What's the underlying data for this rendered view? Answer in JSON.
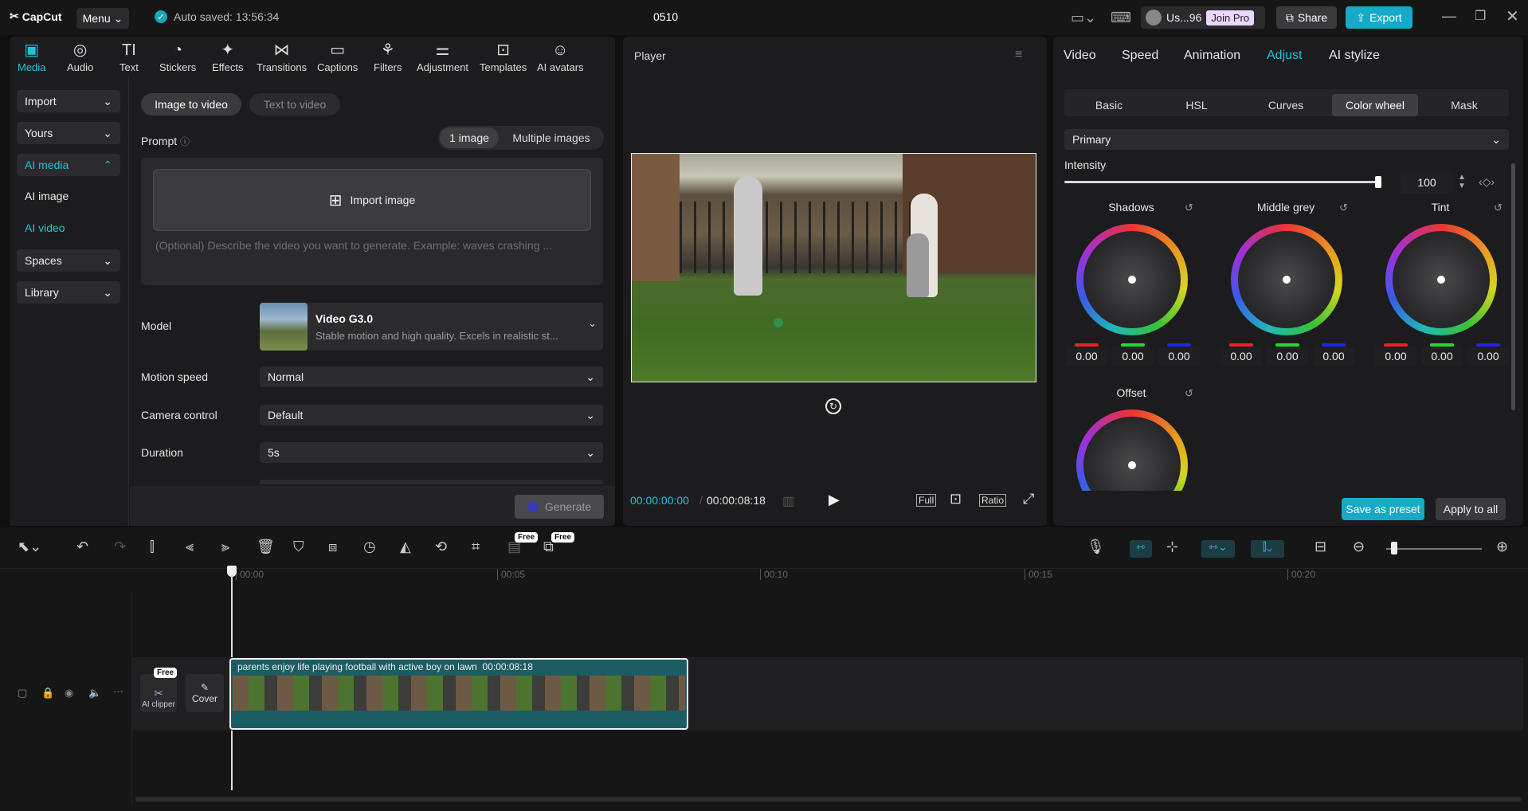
{
  "app": {
    "logo": "CapCut",
    "menu": "Menu",
    "autosave": "Auto saved: 13:56:34",
    "project": "0510",
    "user": "Us...96",
    "join_pro": "Join Pro",
    "share": "Share",
    "export": "Export"
  },
  "media_tabs": [
    "Media",
    "Audio",
    "Text",
    "Stickers",
    "Effects",
    "Transitions",
    "Captions",
    "Filters",
    "Adjustment",
    "Templates",
    "AI avatars"
  ],
  "sidebar": {
    "import": "Import",
    "yours": "Yours",
    "ai_media": "AI media",
    "ai_image": "AI image",
    "ai_video": "AI video",
    "spaces": "Spaces",
    "library": "Library"
  },
  "gen": {
    "image_to_video": "Image to video",
    "text_to_video": "Text to video",
    "prompt": "Prompt",
    "one_image": "1 image",
    "multiple_images": "Multiple images",
    "import_image": "Import image",
    "placeholder": "(Optional) Describe the video you want to generate. Example: waves crashing ...",
    "model_label": "Model",
    "model_name": "Video G3.0",
    "model_desc": "Stable motion and high quality. Excels in realistic st...",
    "motion_label": "Motion speed",
    "motion_value": "Normal",
    "camera_label": "Camera control",
    "camera_value": "Default",
    "duration_label": "Duration",
    "duration_value": "5s",
    "generate": "Generate"
  },
  "player": {
    "title": "Player",
    "current": "00:00:00:00",
    "total": "00:00:08:18",
    "full": "Full",
    "ratio": "Ratio"
  },
  "props": {
    "tabs": [
      "Video",
      "Speed",
      "Animation",
      "Adjust",
      "AI stylize"
    ],
    "subtabs": [
      "Basic",
      "HSL",
      "Curves",
      "Color wheel",
      "Mask"
    ],
    "primary": "Primary",
    "intensity_label": "Intensity",
    "intensity": "100",
    "wheels": [
      {
        "name": "Shadows",
        "r": "0.00",
        "g": "0.00",
        "b": "0.00"
      },
      {
        "name": "Middle grey",
        "r": "0.00",
        "g": "0.00",
        "b": "0.00"
      },
      {
        "name": "Tint",
        "r": "0.00",
        "g": "0.00",
        "b": "0.00"
      },
      {
        "name": "Offset"
      }
    ],
    "save_preset": "Save as preset",
    "apply_all": "Apply to all"
  },
  "timeline": {
    "ticks": [
      "00:00",
      "00:05",
      "00:10",
      "00:15",
      "00:20"
    ],
    "free": "Free",
    "ai_clipper": "AI clipper",
    "cover": "Cover",
    "clip_title": "parents enjoy life playing football with active boy on lawn",
    "clip_duration": "00:00:08:18"
  },
  "colors": {
    "accent": "#1fc5d6",
    "export": "#16a9c8",
    "clip": "#1c5d63"
  }
}
